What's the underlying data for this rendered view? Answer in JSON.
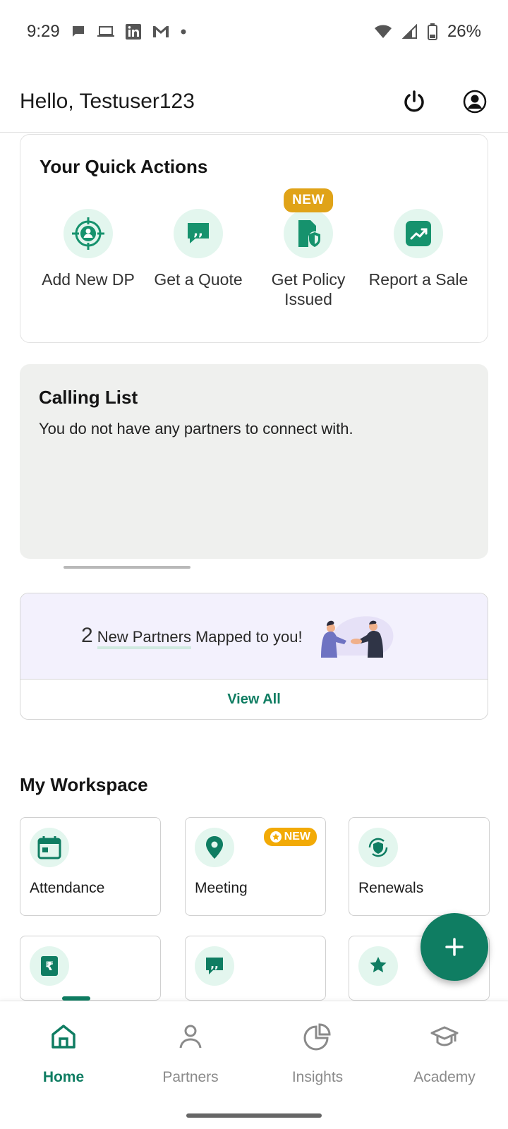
{
  "status_bar": {
    "time": "9:29",
    "battery": "26%"
  },
  "header": {
    "greeting": "Hello, Testuser123"
  },
  "quick_actions": {
    "title": "Your Quick Actions",
    "new_badge": "NEW",
    "items": [
      {
        "label": "Add New DP"
      },
      {
        "label": "Get a Quote"
      },
      {
        "label": "Get Policy Issued"
      },
      {
        "label": "Report a Sale"
      }
    ]
  },
  "calling_list": {
    "title": "Calling List",
    "message": "You do not have any partners to connect with."
  },
  "partners": {
    "count": "2",
    "text_highlight": "New Partners",
    "text_rest": "Mapped to you!",
    "view_all": "View All"
  },
  "workspace": {
    "title": "My Workspace",
    "new_badge": "NEW",
    "tiles": [
      {
        "label": "Attendance"
      },
      {
        "label": "Meeting"
      },
      {
        "label": "Renewals"
      }
    ]
  },
  "bottom_nav": {
    "items": [
      {
        "label": "Home"
      },
      {
        "label": "Partners"
      },
      {
        "label": "Insights"
      },
      {
        "label": "Academy"
      }
    ]
  },
  "colors": {
    "accent": "#0f7d62",
    "icon_bg": "#e3f6ee",
    "new_badge": "#e0a318"
  }
}
